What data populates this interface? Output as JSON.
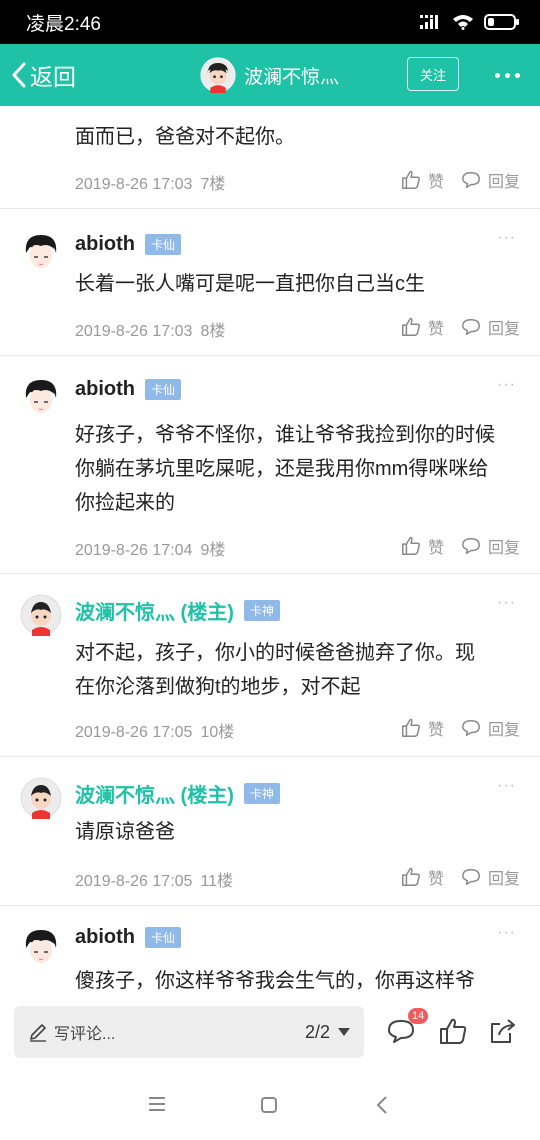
{
  "status_bar": {
    "time": "凌晨2:46"
  },
  "nav": {
    "back_label": "返回",
    "title": "波澜不惊灬",
    "follow_label": "关注",
    "accent_color": "#1fc2a6"
  },
  "posts": [
    {
      "text": "面而已，爸爸对不起你。",
      "date": "2019-8-26 17:03",
      "floor": "7楼",
      "like_label": "赞",
      "reply_label": "回复"
    },
    {
      "username": "abioth",
      "badge": "卡仙",
      "text": "长着一张人嘴可是呢一直把你自己当c生",
      "date": "2019-8-26 17:03",
      "floor": "8楼",
      "like_label": "赞",
      "reply_label": "回复"
    },
    {
      "username": "abioth",
      "badge": "卡仙",
      "text": "好孩子，爷爷不怪你，谁让爷爷我捡到你的时候你躺在茅坑里吃屎呢，还是我用你mm得咪咪给你捡起来的",
      "date": "2019-8-26 17:04",
      "floor": "9楼",
      "like_label": "赞",
      "reply_label": "回复"
    },
    {
      "username": "波澜不惊灬 (楼主)",
      "badge": "卡神",
      "text": "对不起，孩子，你小的时候爸爸抛弃了你。现在你沦落到做狗t的地步，对不起",
      "date": "2019-8-26 17:05",
      "floor": "10楼",
      "like_label": "赞",
      "reply_label": "回复"
    },
    {
      "username": "波澜不惊灬 (楼主)",
      "badge": "卡神",
      "text": "请原谅爸爸",
      "date": "2019-8-26 17:05",
      "floor": "11楼",
      "like_label": "赞",
      "reply_label": "回复"
    },
    {
      "username": "abioth",
      "badge": "卡仙",
      "text": "傻孩子，你这样爷爷我会生气的，你再这样爷"
    }
  ],
  "bottom_bar": {
    "comment_placeholder": "写评论...",
    "page_indicator": "2/2",
    "comment_count": "14"
  }
}
